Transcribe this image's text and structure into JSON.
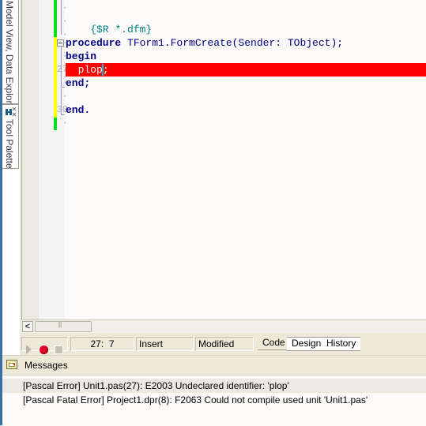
{
  "side_tabs": [
    {
      "label": "Model View, Data Explorer"
    },
    {
      "label": "Tool Palette",
      "icon": "tool-palette-icon"
    }
  ],
  "editor": {
    "line_numbers": [
      {
        "text": "·"
      },
      {
        "text": "·"
      },
      {
        "text": "·"
      },
      {
        "text": "–"
      },
      {
        "text": "·"
      },
      {
        "text": "27"
      },
      {
        "text": "·"
      },
      {
        "text": "·"
      },
      {
        "text": "30"
      },
      {
        "text": "·"
      }
    ],
    "lines": {
      "directive": "{$R *.dfm}",
      "procedure_kw": "procedure",
      "procedure_rest": " TForm1.FormCreate(Sender: TObject);",
      "begin": "begin",
      "error_code_before_caret": "  plop",
      "error_code_after_caret": ";",
      "end_semicolon": "end;",
      "end_dot": "end."
    },
    "error_line_color": "#ff0000",
    "change_bar_saved_color": "#00e020",
    "change_bar_modified_color": "#ffff00"
  },
  "status_bar": {
    "position": "27:  7",
    "mode": "Insert",
    "state": "Modified",
    "view_tabs": [
      {
        "label": "Code",
        "active": true
      },
      {
        "label": "Design",
        "active": false
      },
      {
        "label": "History",
        "active": false
      }
    ]
  },
  "messages": {
    "title": "Messages",
    "items": [
      {
        "text": "[Pascal Error] Unit1.pas(27): E2003 Undeclared identifier: 'plop'"
      },
      {
        "text": "[Pascal Fatal Error] Project1.dpr(8): F2063 Could not compile used unit 'Unit1.pas'"
      }
    ]
  }
}
